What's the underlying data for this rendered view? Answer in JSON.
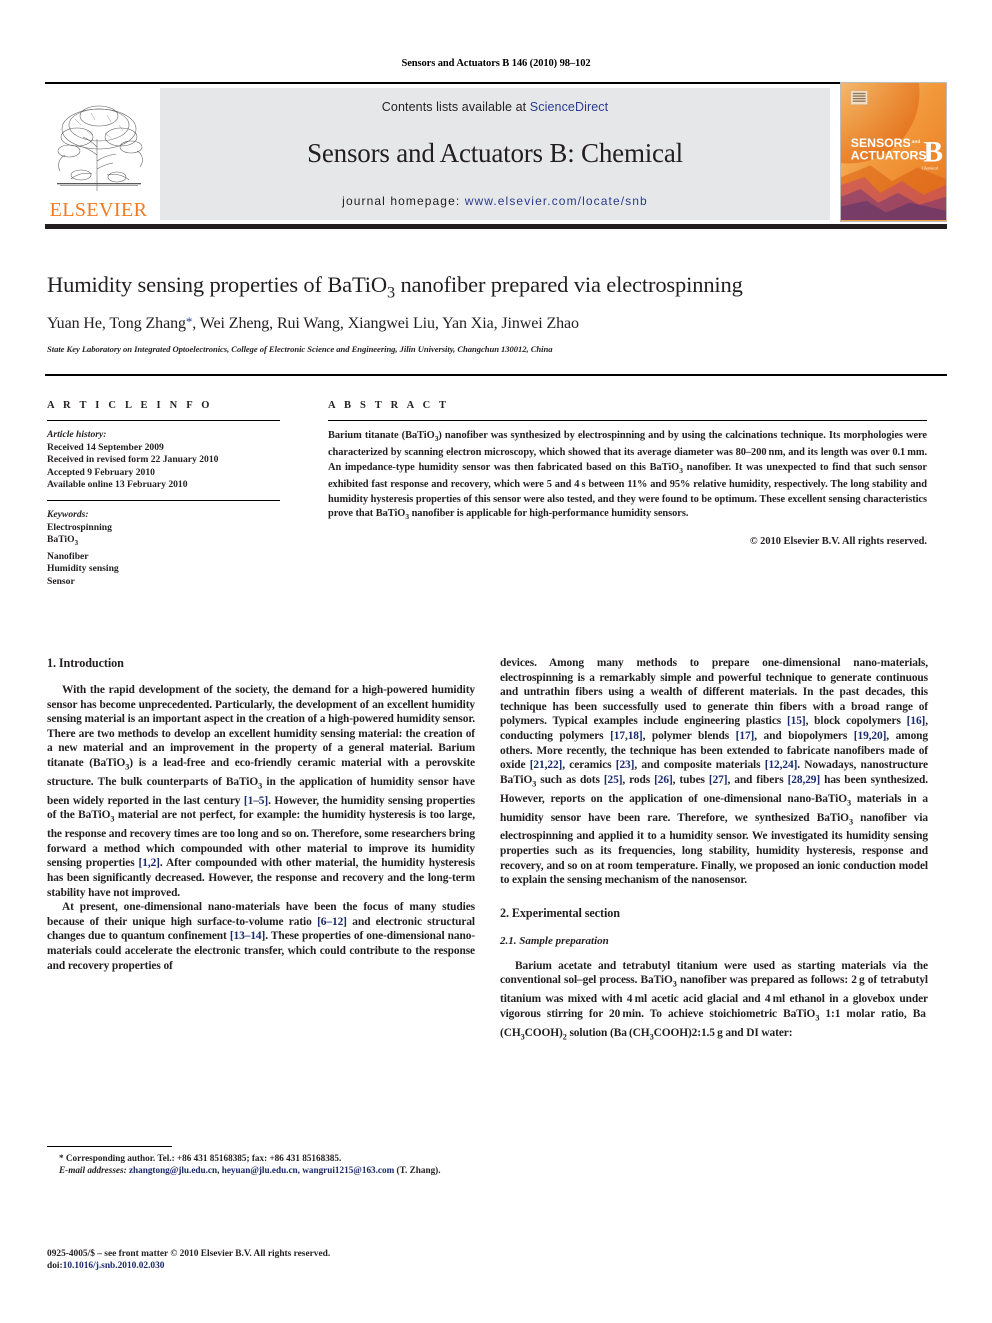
{
  "running_head": "Sensors and Actuators B 146 (2010) 98–102",
  "masthead": {
    "contents_prefix": "Contents lists available at ",
    "sciencedirect": "ScienceDirect",
    "journal_name": "Sensors and Actuators B: Chemical",
    "homepage_label": "journal homepage: ",
    "homepage_url": "www.elsevier.com/locate/snb",
    "publisher_logo_text": "ELSEVIER",
    "cover_line_1": "SENSORS",
    "cover_line_1b": "and",
    "cover_line_2": "ACTUATORS",
    "cover_letter": "B",
    "cover_sub": "Chemical",
    "link_color": "#2a3b8f",
    "brand_orange": "#f47b20",
    "banner_bg": "#e6e7e8"
  },
  "article": {
    "title_part1": "Humidity sensing properties of BaTiO",
    "title_sub": "3",
    "title_part2": " nanofiber prepared via electrospinning",
    "authors_part1": "Yuan He, Tong Zhang",
    "authors_star": "*",
    "authors_part2": ", Wei Zheng, Rui Wang, Xiangwei Liu, Yan Xia, Jinwei Zhao",
    "affiliation": "State Key Laboratory on Integrated Optoelectronics, College of Electronic Science and Engineering, Jilin University, Changchun 130012, China"
  },
  "article_info": {
    "heading": "A R T I C L E  I N F O",
    "history_label": "Article history:",
    "history": [
      "Received 14 September 2009",
      "Received in revised form 22 January 2010",
      "Accepted 9 February 2010",
      "Available online 13 February 2010"
    ],
    "keywords_label": "Keywords:",
    "keywords": [
      "Electrospinning",
      "BaTiO3",
      "Nanofiber",
      "Humidity sensing",
      "Sensor"
    ]
  },
  "abstract": {
    "heading": "A B S T R A C T",
    "copyright": "© 2010 Elsevier B.V. All rights reserved."
  },
  "body": {
    "intro_heading": "1.  Introduction",
    "experimental_heading": "2.  Experimental section",
    "sample_prep_heading": "2.1.  Sample preparation"
  },
  "footnotes": {
    "corresponding": "* Corresponding author. Tel.: +86 431 85168385; fax: +86 431 85168385.",
    "email_label": "E-mail addresses:",
    "emails": "zhangtong@jlu.edu.cn, heyuan@jlu.edu.cn, wangrui1215@163.com",
    "email_suffix": " (T. Zhang).",
    "imprint": "0925-4005/$ – see front matter © 2010 Elsevier B.V. All rights reserved.",
    "doi_label": "doi:",
    "doi": "10.1016/j.snb.2010.02.030"
  }
}
